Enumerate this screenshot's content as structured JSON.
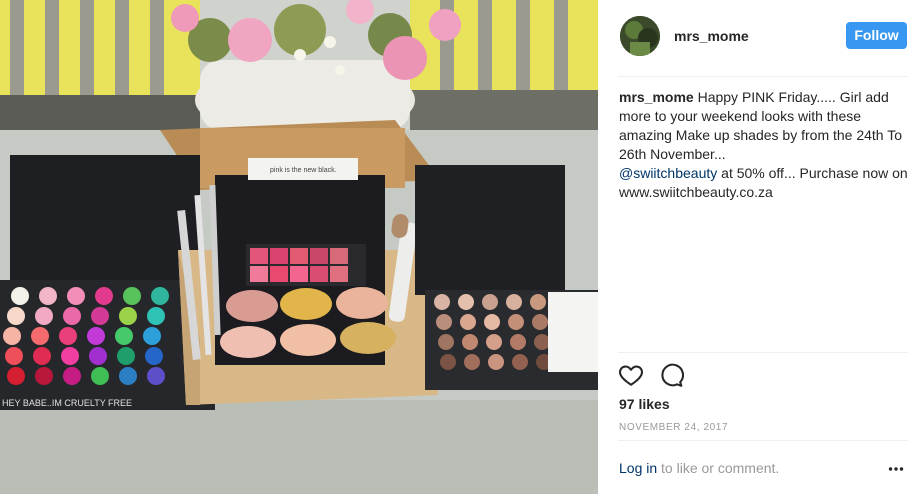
{
  "post": {
    "username": "mrs_mome",
    "follow_label": "Follow",
    "caption": {
      "username": "mrs_mome",
      "text_part1": " Happy PINK Friday..... Girl add more to your weekend looks with these amazing Make up shades by from the 24th To 26th November...",
      "mention": "@swiitchbeauty",
      "text_part2": " at 50% off... Purchase now on www.swiitchbeauty.co.za"
    },
    "likes": "97 likes",
    "date": "NOVEMBER 24, 2017",
    "comment_prompt": {
      "login_label": "Log in",
      "rest": " to like or comment."
    }
  },
  "photo": {
    "box_card_text": "pink is the new black.",
    "palette_left_text": "HEY BABE..IM CRUELTY FREE"
  },
  "icons": {
    "like": "heart-icon",
    "comment": "comment-icon",
    "more": "more-options-icon"
  },
  "colors": {
    "follow_button": "#3897f0",
    "link": "#003569",
    "muted": "#999999",
    "text": "#262626"
  }
}
